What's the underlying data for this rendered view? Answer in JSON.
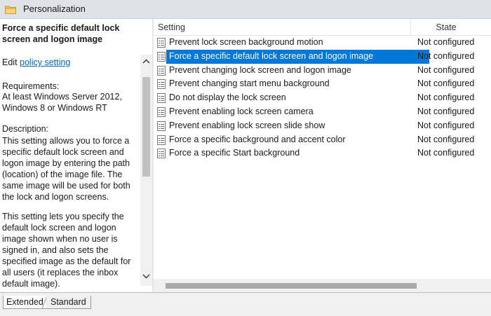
{
  "window": {
    "title": "Personalization"
  },
  "left_pane": {
    "policy_title": "Force a specific default lock screen and logon image",
    "edit_prefix": "Edit",
    "edit_link": "policy setting",
    "requirements_label": "Requirements:",
    "requirements_text": "At least Windows Server 2012, Windows 8 or Windows RT",
    "description_label": "Description:",
    "description_p1": "This setting allows you to force a specific default lock screen and logon image by entering the path (location) of the image file. The same image will be used for both the lock and logon screens.",
    "description_p2": "This setting lets you specify the default lock screen and logon image shown when no user is signed in, and also sets the specified image as the default for all users (it replaces the inbox default image)."
  },
  "list": {
    "columns": [
      "Setting",
      "State"
    ],
    "rows": [
      {
        "name": "Prevent lock screen background motion",
        "state": "Not configured",
        "selected": false
      },
      {
        "name": "Force a specific default lock screen and logon image",
        "state": "Not configured",
        "selected": true
      },
      {
        "name": "Prevent changing lock screen and logon image",
        "state": "Not configured",
        "selected": false
      },
      {
        "name": "Prevent changing start menu background",
        "state": "Not configured",
        "selected": false
      },
      {
        "name": "Do not display the lock screen",
        "state": "Not configured",
        "selected": false
      },
      {
        "name": "Prevent enabling lock screen camera",
        "state": "Not configured",
        "selected": false
      },
      {
        "name": "Prevent enabling lock screen slide show",
        "state": "Not configured",
        "selected": false
      },
      {
        "name": "Force a specific background and accent color",
        "state": "Not configured",
        "selected": false
      },
      {
        "name": "Force a specific Start background",
        "state": "Not configured",
        "selected": false
      }
    ]
  },
  "tabs": {
    "extended": "Extended",
    "standard": "Standard",
    "active": "Extended"
  },
  "icons": {
    "title": "folder-icon",
    "row": "policy-setting-icon",
    "scroll_up": "chevron-up-icon",
    "scroll_down": "chevron-down-icon"
  },
  "colors": {
    "selection": "#0078d7",
    "link": "#0066cc",
    "folder": "#e8b84a"
  }
}
